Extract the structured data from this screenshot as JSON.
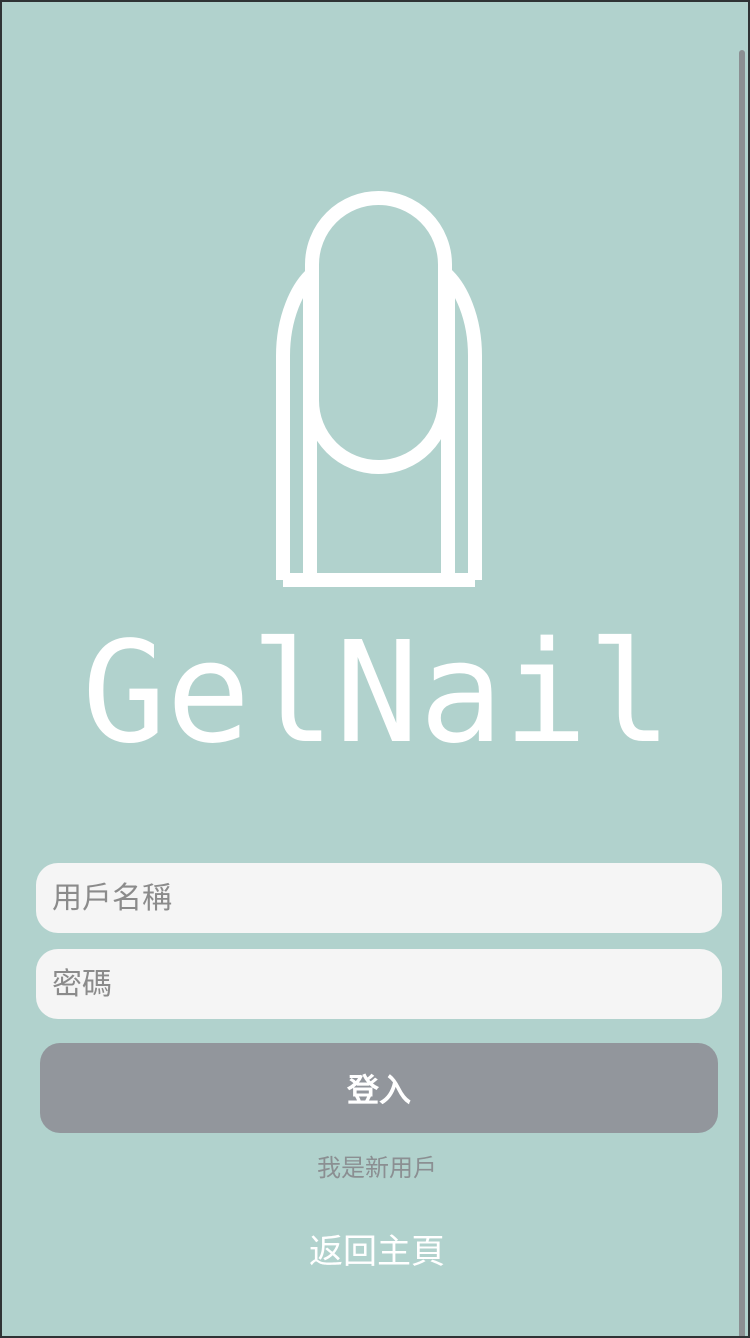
{
  "brand": {
    "name": "GelNail",
    "logo_icon": "nail-icon"
  },
  "form": {
    "username_placeholder": "用戶名稱",
    "password_placeholder": "密碼",
    "login_label": "登入"
  },
  "links": {
    "new_user": "我是新用戶",
    "back_home": "返回主頁"
  },
  "colors": {
    "background": "#b1d2cd",
    "input_background": "#f5f5f5",
    "button_background": "#92969c",
    "text_white": "#ffffff",
    "muted_text": "#8b8f92"
  }
}
